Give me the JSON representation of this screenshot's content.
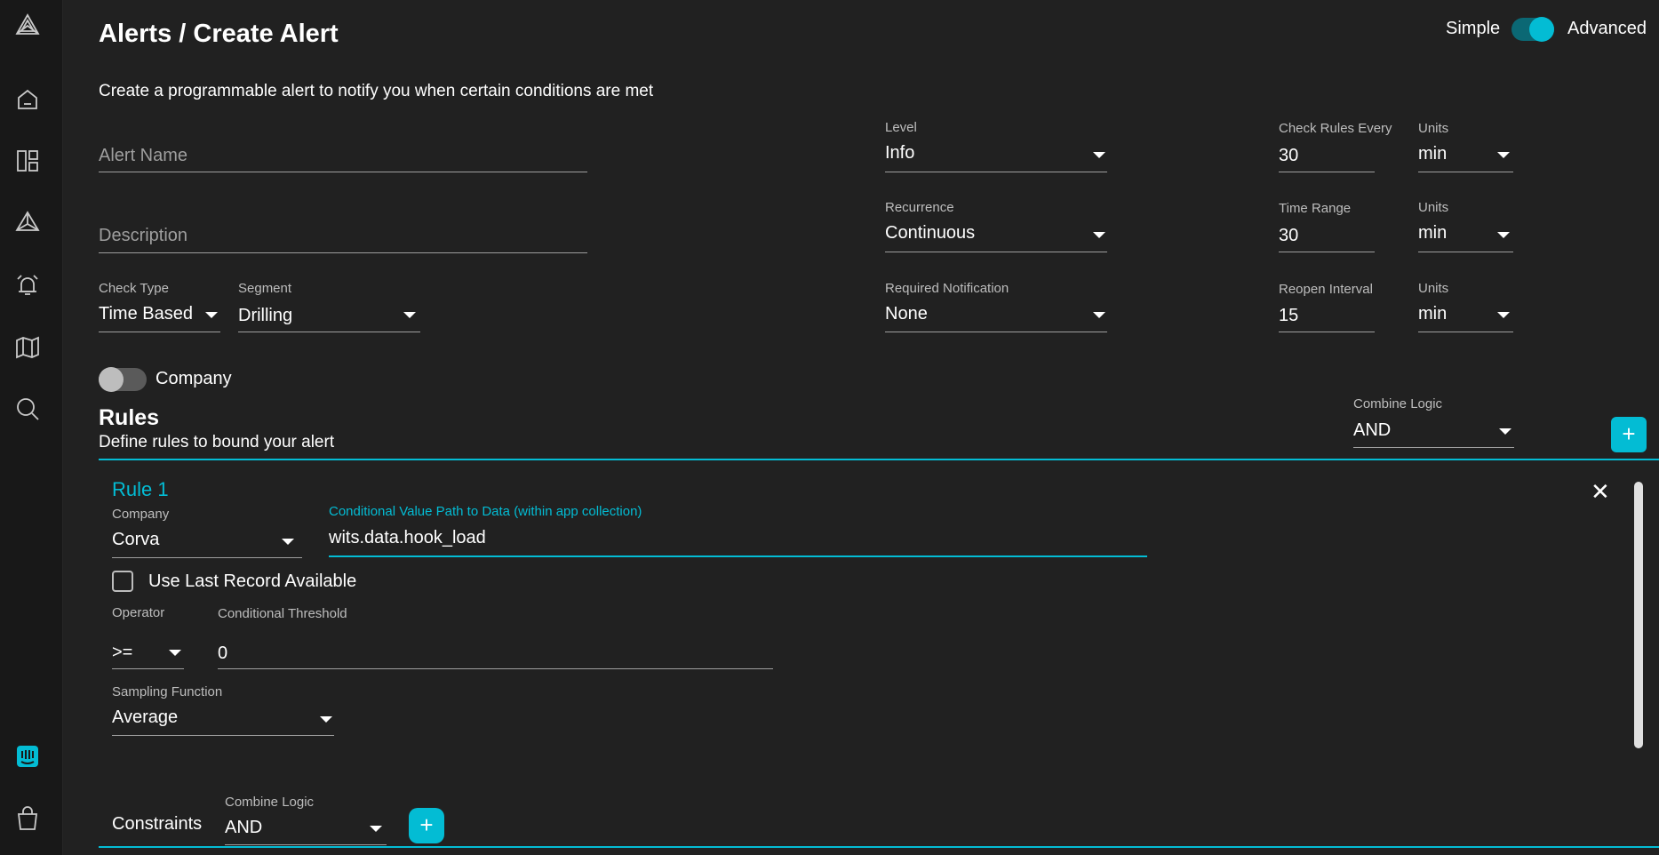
{
  "sidebar": {
    "items": [
      {
        "name": "logo-icon"
      },
      {
        "name": "home-icon"
      },
      {
        "name": "dashboard-icon"
      },
      {
        "name": "apps-icon"
      },
      {
        "name": "alarm-icon"
      },
      {
        "name": "map-icon"
      },
      {
        "name": "search-icon"
      },
      {
        "name": "intercom-icon"
      },
      {
        "name": "shopping-bag-icon"
      }
    ],
    "active_color": "#03bcd4"
  },
  "header": {
    "title": "Alerts / Create Alert",
    "description": "Create a programmable alert to notify you when certain conditions are met",
    "mode_simple": "Simple",
    "mode_advanced": "Advanced",
    "mode_is_advanced": true
  },
  "form": {
    "alert_name_placeholder": "Alert Name",
    "description_placeholder": "Description",
    "check_type": {
      "label": "Check Type",
      "value": "Time Based"
    },
    "segment": {
      "label": "Segment",
      "value": "Drilling"
    },
    "company_toggle": {
      "label": "Company",
      "on": false
    },
    "level": {
      "label": "Level",
      "value": "Info"
    },
    "recurrence": {
      "label": "Recurrence",
      "value": "Continuous"
    },
    "required_notification": {
      "label": "Required Notification",
      "value": "None"
    },
    "check_rules_every": {
      "label": "Check Rules Every",
      "value": "30",
      "units_label": "Units",
      "units": "min"
    },
    "time_range": {
      "label": "Time Range",
      "value": "30",
      "units_label": "Units",
      "units": "min"
    },
    "reopen_interval": {
      "label": "Reopen Interval",
      "value": "15",
      "units_label": "Units",
      "units": "min"
    }
  },
  "rules": {
    "title": "Rules",
    "subtitle": "Define rules to bound your alert",
    "combine_logic": {
      "label": "Combine Logic",
      "value": "AND"
    },
    "add_label": "+",
    "rule1": {
      "title": "Rule 1",
      "close_label": "✕",
      "company": {
        "label": "Company",
        "value": "Corva"
      },
      "path": {
        "label": "Conditional Value Path to Data (within app collection)",
        "value": "wits.data.hook_load"
      },
      "use_last_record": {
        "label": "Use Last Record Available",
        "checked": false
      },
      "operator": {
        "label": "Operator",
        "value": ">="
      },
      "threshold": {
        "label": "Conditional Threshold",
        "value": "0"
      },
      "sampling": {
        "label": "Sampling Function",
        "value": "Average"
      }
    },
    "constraints": {
      "label": "Constraints",
      "combine_logic": {
        "label": "Combine Logic",
        "value": "AND"
      },
      "add_label": "+"
    }
  },
  "colors": {
    "accent": "#03bcd4",
    "background": "#212121",
    "sidebar": "#181818"
  }
}
